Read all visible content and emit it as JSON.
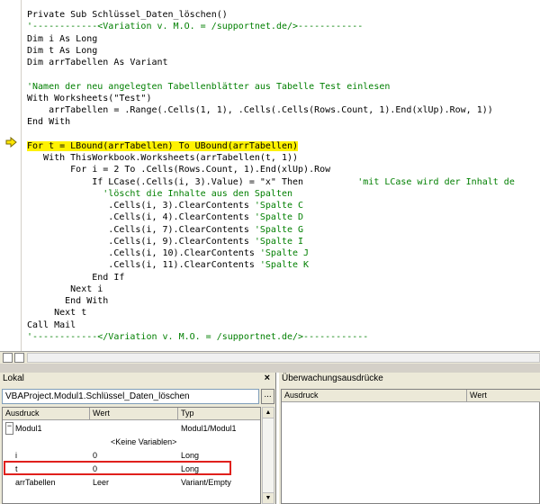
{
  "code": {
    "lines": [
      {
        "text": "Private Sub Schlüssel_Daten_löschen()",
        "style": "plain"
      },
      {
        "text": "'------------<Variation v. M.O. = /supportnet.de/>------------",
        "style": "comment"
      },
      {
        "text": "Dim i As Long",
        "style": "plain"
      },
      {
        "text": "Dim t As Long",
        "style": "plain"
      },
      {
        "text": "Dim arrTabellen As Variant",
        "style": "plain"
      },
      {
        "text": "",
        "style": "plain"
      },
      {
        "text": "'Namen der neu angelegten Tabellenblätter aus Tabelle Test einlesen",
        "style": "comment"
      },
      {
        "text": "With Worksheets(\"Test\")",
        "style": "plain"
      },
      {
        "text": "    arrTabellen = .Range(.Cells(1, 1), .Cells(.Cells(Rows.Count, 1).End(xlUp).Row, 1))",
        "style": "plain"
      },
      {
        "text": "End With",
        "style": "plain"
      },
      {
        "text": "",
        "style": "plain"
      },
      {
        "text": "For t = LBound(arrTabellen) To UBound(arrTabellen)",
        "style": "highlight"
      },
      {
        "text": "   With ThisWorkbook.Worksheets(arrTabellen(t, 1))",
        "style": "plain"
      },
      {
        "text": "        For i = 2 To .Cells(Rows.Count, 1).End(xlUp).Row",
        "style": "plain"
      },
      {
        "text": "            If LCase(.Cells(i, 3).Value) = \"x\" Then",
        "style": "plain",
        "comment": "          'mit LCase wird der Inhalt de"
      },
      {
        "text": "              'löscht die Inhalte aus den Spalten",
        "style": "comment"
      },
      {
        "text": "               .Cells(i, 3).ClearContents",
        "style": "plain",
        "comment": " 'Spalte C"
      },
      {
        "text": "               .Cells(i, 4).ClearContents",
        "style": "plain",
        "comment": " 'Spalte D"
      },
      {
        "text": "               .Cells(i, 7).ClearContents",
        "style": "plain",
        "comment": " 'Spalte G"
      },
      {
        "text": "               .Cells(i, 9).ClearContents",
        "style": "plain",
        "comment": " 'Spalte I"
      },
      {
        "text": "               .Cells(i, 10).ClearContents",
        "style": "plain",
        "comment": " 'Spalte J"
      },
      {
        "text": "               .Cells(i, 11).ClearContents",
        "style": "plain",
        "comment": " 'Spalte K"
      },
      {
        "text": "            End If",
        "style": "plain"
      },
      {
        "text": "        Next i",
        "style": "plain"
      },
      {
        "text": "       End With",
        "style": "plain"
      },
      {
        "text": "     Next t",
        "style": "plain"
      },
      {
        "text": "Call Mail",
        "style": "plain"
      },
      {
        "text": "'------------</Variation v. M.O. = /supportnet.de/>------------",
        "style": "comment"
      }
    ],
    "exec_arrow_color": "#ffe600"
  },
  "locals": {
    "title": "Lokal",
    "close": "×",
    "context": "VBAProject.Modul1.Schlüssel_Daten_löschen",
    "context_button": "...",
    "columns": [
      "Ausdruck",
      "Wert",
      "Typ"
    ],
    "rows": [
      {
        "expr": "Modul1",
        "value": "",
        "type": "Modul1/Modul1",
        "expander": "−",
        "indent": 0
      },
      {
        "expr": "",
        "value": "<Keine Variablen>",
        "type": "",
        "indent": 1
      },
      {
        "expr": "i",
        "value": "0",
        "type": "Long",
        "indent": 0
      },
      {
        "expr": "t",
        "value": "0",
        "type": "Long",
        "indent": 0
      },
      {
        "expr": "arrTabellen",
        "value": "Leer",
        "type": "Variant/Empty",
        "indent": 0
      }
    ]
  },
  "watch": {
    "title": "Überwachungsausdrücke",
    "columns": [
      "Ausdruck",
      "Wert"
    ]
  }
}
